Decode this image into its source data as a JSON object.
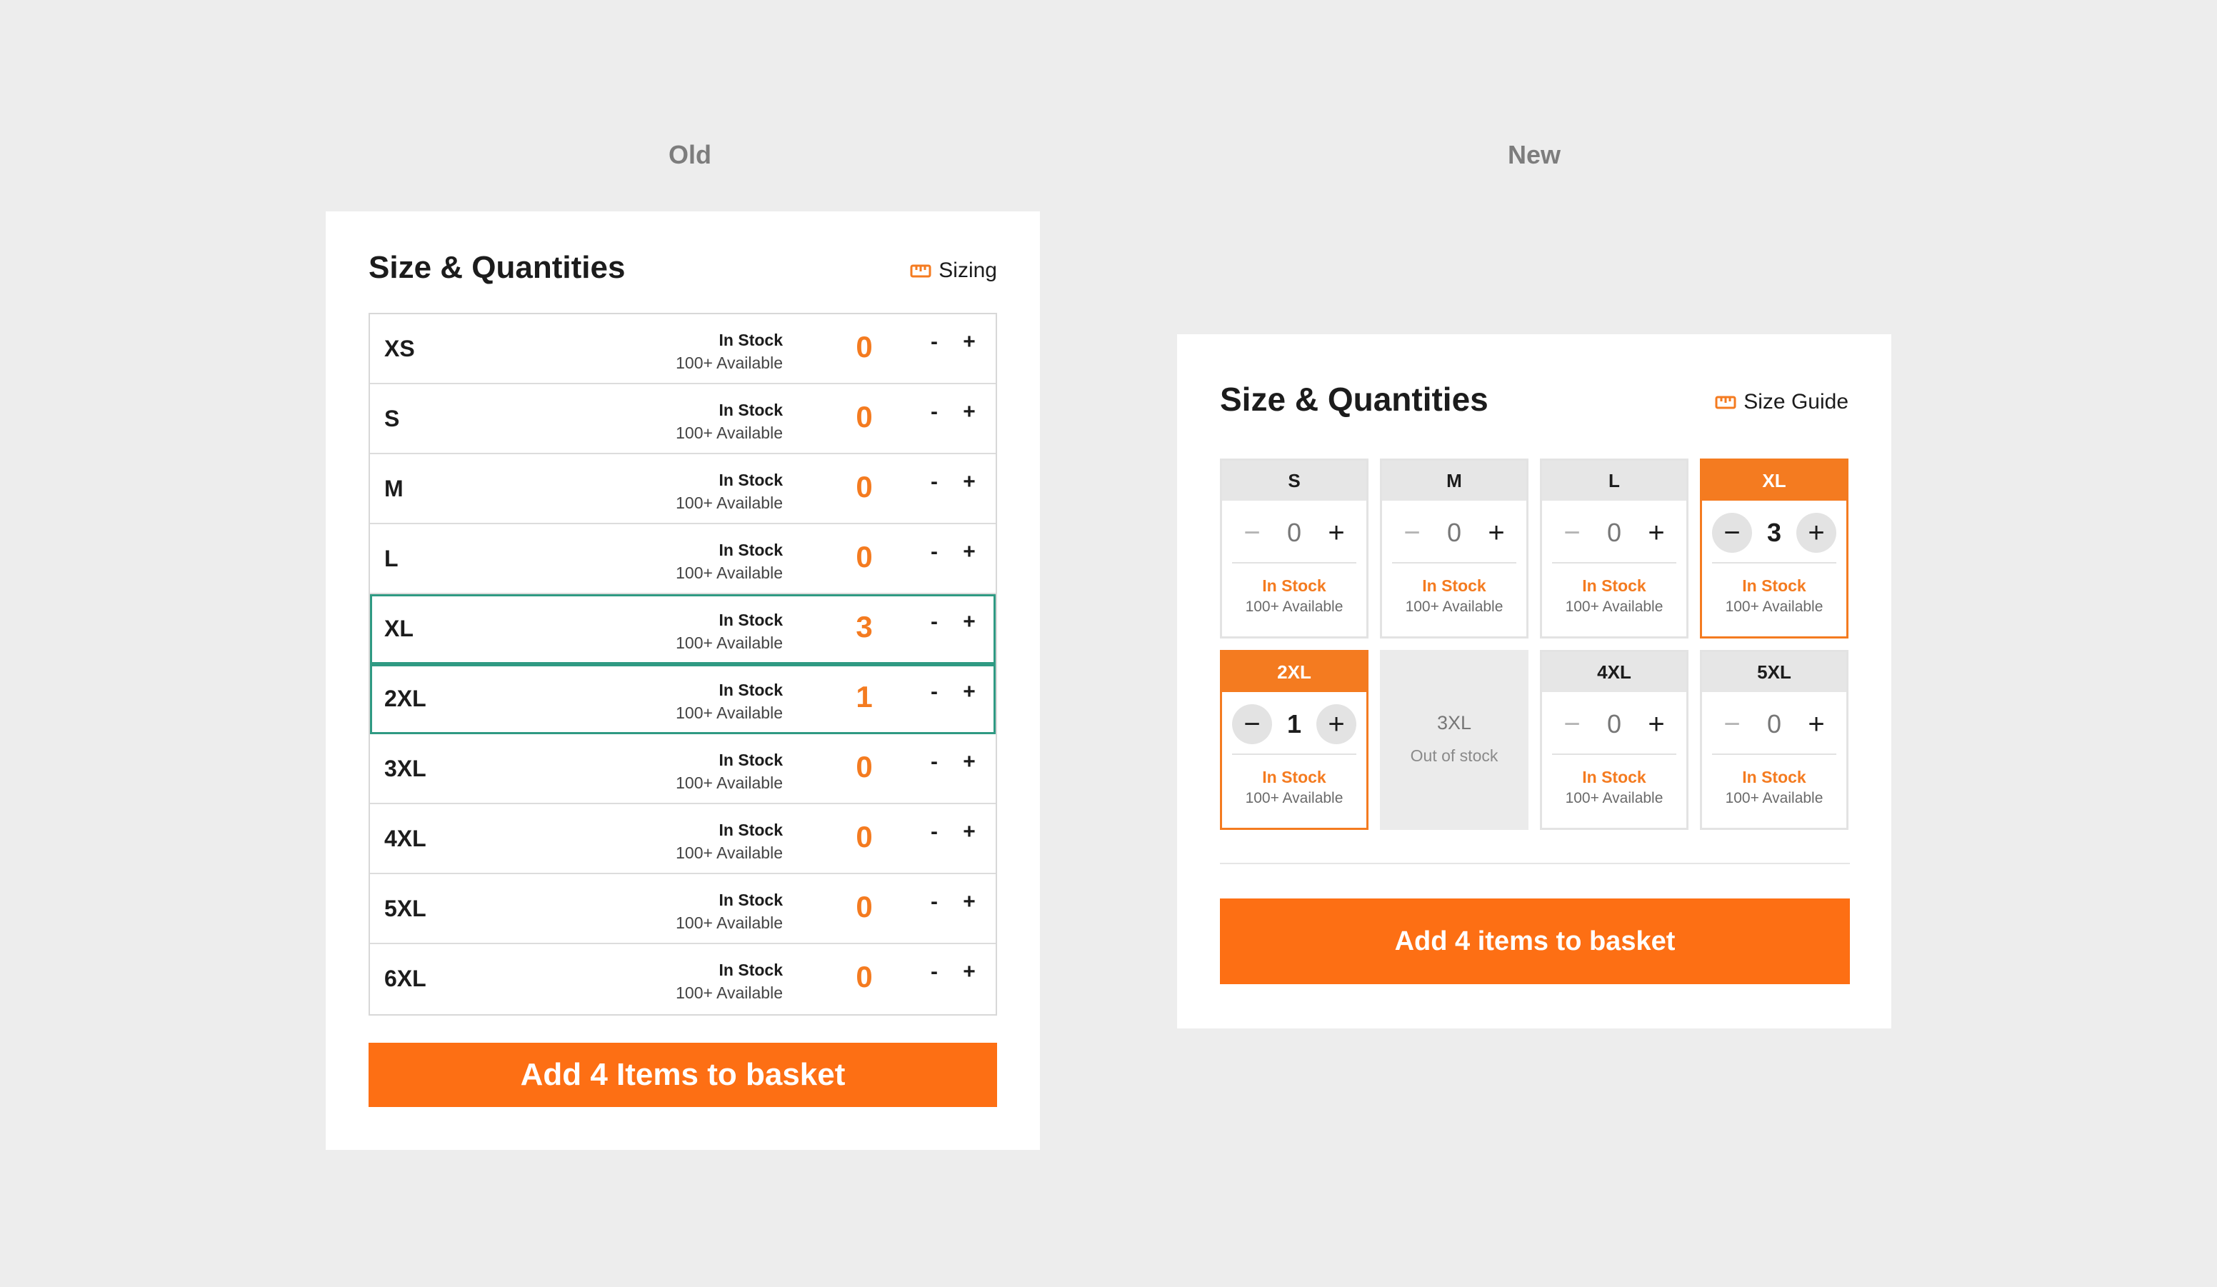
{
  "labels": {
    "old": "Old",
    "new": "New"
  },
  "old": {
    "title": "Size & Quantities",
    "sizing_link": "Sizing",
    "sizing_icon": "ruler-icon",
    "rows": [
      {
        "size": "XS",
        "status": "In Stock",
        "available": "100+ Available",
        "qty": "0",
        "selected": false
      },
      {
        "size": "S",
        "status": "In Stock",
        "available": "100+ Available",
        "qty": "0",
        "selected": false
      },
      {
        "size": "M",
        "status": "In Stock",
        "available": "100+ Available",
        "qty": "0",
        "selected": false
      },
      {
        "size": "L",
        "status": "In Stock",
        "available": "100+ Available",
        "qty": "0",
        "selected": false
      },
      {
        "size": "XL",
        "status": "In Stock",
        "available": "100+ Available",
        "qty": "3",
        "selected": true
      },
      {
        "size": "2XL",
        "status": "In Stock",
        "available": "100+ Available",
        "qty": "1",
        "selected": true
      },
      {
        "size": "3XL",
        "status": "In Stock",
        "available": "100+ Available",
        "qty": "0",
        "selected": false
      },
      {
        "size": "4XL",
        "status": "In Stock",
        "available": "100+ Available",
        "qty": "0",
        "selected": false
      },
      {
        "size": "5XL",
        "status": "In Stock",
        "available": "100+ Available",
        "qty": "0",
        "selected": false
      },
      {
        "size": "6XL",
        "status": "In Stock",
        "available": "100+ Available",
        "qty": "0",
        "selected": false
      }
    ],
    "minus_label": "-",
    "plus_label": "+",
    "add_button": "Add 4 Items to basket"
  },
  "new": {
    "title": "Size & Quantities",
    "sizing_link": "Size Guide",
    "sizing_icon": "ruler-icon",
    "tiles": [
      {
        "size": "S",
        "qty": "0",
        "status": "In Stock",
        "available": "100+ Available",
        "active": false,
        "out_of_stock": false
      },
      {
        "size": "M",
        "qty": "0",
        "status": "In Stock",
        "available": "100+ Available",
        "active": false,
        "out_of_stock": false
      },
      {
        "size": "L",
        "qty": "0",
        "status": "In Stock",
        "available": "100+ Available",
        "active": false,
        "out_of_stock": false
      },
      {
        "size": "XL",
        "qty": "3",
        "status": "In Stock",
        "available": "100+ Available",
        "active": true,
        "out_of_stock": false
      },
      {
        "size": "2XL",
        "qty": "1",
        "status": "In Stock",
        "available": "100+ Available",
        "active": true,
        "out_of_stock": false
      },
      {
        "size": "3XL",
        "status": "Out of stock",
        "out_of_stock": true
      },
      {
        "size": "4XL",
        "qty": "0",
        "status": "In Stock",
        "available": "100+ Available",
        "active": false,
        "out_of_stock": false
      },
      {
        "size": "5XL",
        "qty": "0",
        "status": "In Stock",
        "available": "100+ Available",
        "active": false,
        "out_of_stock": false
      }
    ],
    "minus_glyph": "−",
    "plus_glyph": "+",
    "add_button": "Add 4 items to basket"
  },
  "colors": {
    "accent": "#f47b20",
    "button": "#fd6f14",
    "selected_outline": "#2f9a83",
    "background": "#ededed"
  }
}
